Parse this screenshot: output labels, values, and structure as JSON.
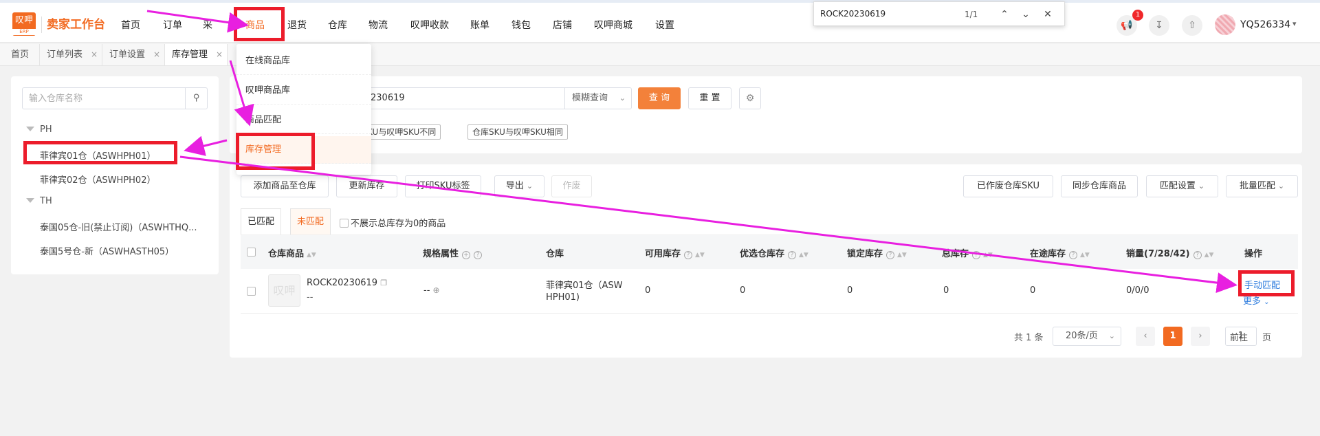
{
  "header": {
    "logo_text": "叹呷",
    "logo_sub": "ERP",
    "brand": "卖家工作台",
    "nav": [
      {
        "label": "首页",
        "active": false
      },
      {
        "label": "订单",
        "active": false
      },
      {
        "label": "采",
        "active": false
      },
      {
        "label": "商品",
        "active": true
      },
      {
        "label": "退货",
        "active": false
      },
      {
        "label": "仓库",
        "active": false
      },
      {
        "label": "物流",
        "active": false
      },
      {
        "label": "叹呷收款",
        "active": false
      },
      {
        "label": "账单",
        "active": false
      },
      {
        "label": "钱包",
        "active": false
      },
      {
        "label": "店铺",
        "active": false
      },
      {
        "label": "叹呷商城",
        "active": false
      },
      {
        "label": "设置",
        "active": false
      }
    ],
    "notification_count": "1",
    "username": "YQ526334"
  },
  "findbar": {
    "query": "ROCK20230619",
    "count": "1/1"
  },
  "page_tabs": [
    {
      "label": "首页",
      "closable": false,
      "active": false
    },
    {
      "label": "订单列表",
      "closable": true,
      "active": false
    },
    {
      "label": "订单设置",
      "closable": true,
      "active": false
    },
    {
      "label": "库存管理",
      "closable": true,
      "active": true
    }
  ],
  "close_glyph": "×",
  "dropdown": {
    "items": [
      {
        "label": "在线商品库",
        "active": false
      },
      {
        "label": "叹呷商品库",
        "active": false
      },
      {
        "label": "商品匹配",
        "active": false
      },
      {
        "label": "库存管理",
        "active": true
      }
    ]
  },
  "warehouse_panel": {
    "search_placeholder": "输入仓库名称",
    "groups": [
      {
        "label": "PH",
        "items": [
          "菲律宾01仓（ASWHPH01）",
          "菲律宾02仓（ASWHPH02）"
        ]
      },
      {
        "label": "TH",
        "items": [
          "泰国05仓-旧(禁止订阅)（ASWHTHQ...",
          "泰国5号仓-新（ASWHASTH05）"
        ]
      }
    ]
  },
  "filters": {
    "keyword_value": "230619",
    "mode": "模糊查询",
    "query_button": "查 询",
    "reset_button": "重 置",
    "tags": [
      "KU与叹呷SKU不同",
      "仓库SKU与叹呷SKU相同"
    ]
  },
  "toolbar": {
    "left": [
      {
        "label": "添加商品至仓库",
        "dropdown": false,
        "disabled": false
      },
      {
        "label": "更新库存",
        "dropdown": false,
        "disabled": false
      },
      {
        "label": "打印SKU标签",
        "dropdown": false,
        "disabled": false
      },
      {
        "label": "导出",
        "dropdown": true,
        "disabled": false
      },
      {
        "label": "作废",
        "dropdown": false,
        "disabled": true
      }
    ],
    "right": [
      {
        "label": "已作废仓库SKU",
        "dropdown": false
      },
      {
        "label": "同步仓库商品",
        "dropdown": false
      },
      {
        "label": "匹配设置",
        "dropdown": true
      },
      {
        "label": "批量匹配",
        "dropdown": true
      }
    ]
  },
  "match_tabs": {
    "matched": "已匹配",
    "unmatched": "未匹配",
    "hide_zero_label": "不展示总库存为0的商品"
  },
  "table": {
    "columns": {
      "product": "仓库商品",
      "spec": "规格属性",
      "warehouse": "仓库",
      "available": "可用库存",
      "preferred": "优选仓库存",
      "locked": "锁定库存",
      "total": "总库存",
      "transit": "在途库存",
      "sales": "销量(7/28/42)",
      "ops": "操作"
    },
    "rows": [
      {
        "thumb_text": "叹呷",
        "sku": "ROCK20230619",
        "sku_sub": "--",
        "spec": "--",
        "warehouse_line1": "菲律宾01仓（ASW",
        "warehouse_line2": "HPH01)",
        "available": "0",
        "preferred": "0",
        "locked": "0",
        "total": "0",
        "transit": "0",
        "sales": "0/0/0",
        "op_primary": "手动匹配",
        "op_more": "更多"
      }
    ]
  },
  "pagination": {
    "total_text": "共 1 条",
    "page_size": "20条/页",
    "current_page": "1",
    "goto_label": "前往",
    "goto_value": "1",
    "page_suffix": "页"
  },
  "annotation_colors": {
    "highlight": "#ec1c2b",
    "arrow": "#e81fe0"
  }
}
